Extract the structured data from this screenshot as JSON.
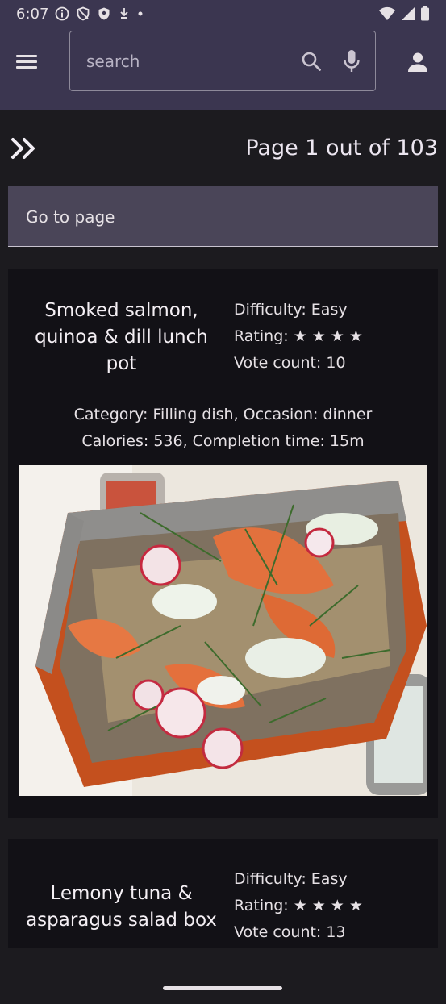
{
  "status_bar": {
    "time": "6:07"
  },
  "search": {
    "placeholder": "search"
  },
  "pager": {
    "label": "Page 1 out of 103"
  },
  "goto_page": {
    "placeholder": "Go to page"
  },
  "recipes": [
    {
      "title": "Smoked salmon, quinoa & dill lunch pot",
      "difficulty": "Difficulty: Easy",
      "rating_label": "Rating:",
      "rating_stars": "★★★★",
      "rating_value": 4,
      "vote_count": "Vote count: 10",
      "category_line": "Category: Filling dish, Occasion: dinner",
      "calories_line": "Calories: 536, Completion time: 15m"
    },
    {
      "title": "Lemony tuna & asparagus salad box",
      "difficulty": "Difficulty: Easy",
      "rating_label": "Rating:",
      "rating_stars": "★★★★",
      "rating_value": 4,
      "vote_count": "Vote count: 13"
    }
  ],
  "colors": {
    "app_bar": "#3b3650",
    "background": "#1c1b1f",
    "card": "#121116",
    "goto_field": "#4a4558",
    "text": "#e6e1e5"
  },
  "icons": [
    "menu-icon",
    "search-icon",
    "mic-icon",
    "account-icon",
    "double-chevron-right-icon",
    "wifi-icon",
    "signal-icon",
    "battery-icon"
  ]
}
